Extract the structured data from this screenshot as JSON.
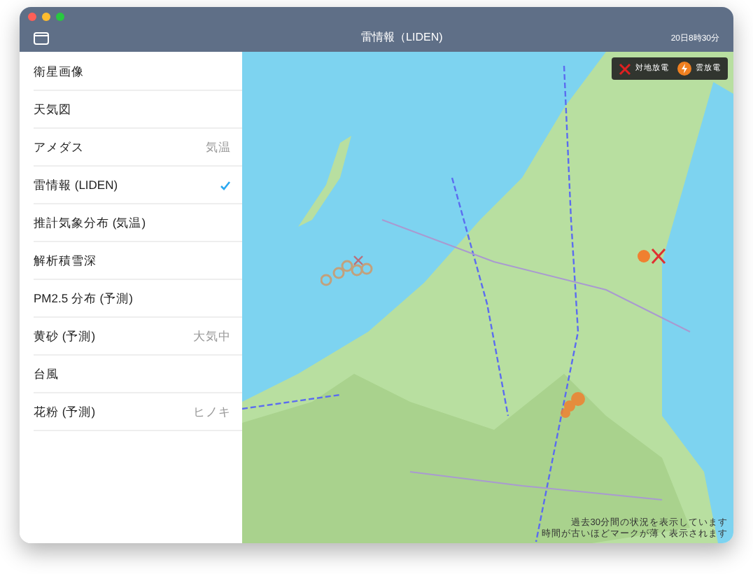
{
  "window": {
    "title": "雷情報（LIDEN)",
    "time": "20日8時30分"
  },
  "sidebar": {
    "items": [
      {
        "label": "衛星画像",
        "selected": false
      },
      {
        "label": "天気図",
        "selected": false
      },
      {
        "label": "アメダス",
        "value": "気温",
        "selected": false
      },
      {
        "label": "雷情報 (LIDEN)",
        "selected": true
      },
      {
        "label": "推計気象分布 (気温)",
        "selected": false
      },
      {
        "label": "解析積雪深",
        "selected": false
      },
      {
        "label": "PM2.5 分布 (予測)",
        "selected": false
      },
      {
        "label": "黄砂 (予測)",
        "value": "大気中",
        "selected": false
      },
      {
        "label": "台風",
        "selected": false
      },
      {
        "label": "花粉 (予測)",
        "value": "ヒノキ",
        "selected": false
      }
    ]
  },
  "map": {
    "legend": [
      {
        "kind": "ground",
        "label": "対地放電"
      },
      {
        "kind": "cloud",
        "label": "雲放電"
      }
    ],
    "note": [
      "過去30分間の状況を表示しています",
      "時間が古いほどマークが薄く表示されます"
    ]
  }
}
